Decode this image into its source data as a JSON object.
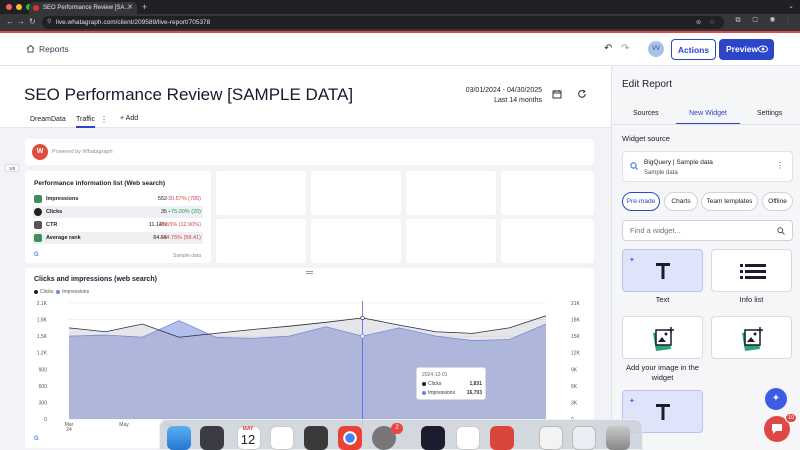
{
  "browser": {
    "tab_title": "SEO Performance Review [SA…",
    "url": "live.whatagraph.com/client/209589/live-report/705378"
  },
  "header": {
    "breadcrumb": "Reports",
    "avatar_initials": "VV",
    "actions_label": "Actions",
    "preview_label": "Preview"
  },
  "report": {
    "title": "SEO Performance Review [SAMPLE DATA]",
    "date_range": "03/01/2024 - 04/30/2025",
    "date_sub": "Last 14 months",
    "pages": [
      "DreamData",
      "Traffic"
    ],
    "add_label": "Add",
    "page_indicator": "1/6",
    "powered_by": "Powered by Whatagraph"
  },
  "perf_list": {
    "title": "Performance information list (Web search)",
    "rows": [
      {
        "label": "Impressions",
        "value": "552",
        "change": "-30.57% (795)",
        "trend": "neg"
      },
      {
        "label": "Clicks",
        "value": "35",
        "change": "+75.00% (20)",
        "trend": "pos"
      },
      {
        "label": "CTR",
        "value": "11.14%",
        "change": "-13.65% (12.90%)",
        "trend": "neg"
      },
      {
        "label": "Average rank",
        "value": "84.55",
        "change": "+44.75% (58.41)",
        "trend": "neg"
      }
    ],
    "source": "Sample data"
  },
  "chart_data": {
    "type": "line",
    "title": "Clicks and impressions (web search)",
    "x": [
      "Mar 24",
      "Apr",
      "May",
      "Jun",
      "Jul",
      "Aug",
      "Sep",
      "Oct",
      "Nov",
      "Dec",
      "Jan",
      "Feb",
      "Mar",
      "Apr"
    ],
    "xlabels_visible": [
      "Mar 24",
      "May",
      "Jun"
    ],
    "series": [
      {
        "name": "Clicks",
        "axis": "left",
        "color": "#1c1c2e",
        "values": [
          1650,
          1580,
          1720,
          1480,
          1550,
          1620,
          1680,
          1750,
          1831,
          1700,
          1580,
          1550,
          1650,
          1870
        ]
      },
      {
        "name": "Impressions",
        "axis": "right",
        "color": "#6a86e3",
        "values": [
          15000,
          15200,
          14800,
          17800,
          14800,
          14600,
          15000,
          16703,
          15000,
          16500,
          15000,
          14200,
          14400,
          17200
        ]
      }
    ],
    "y_left": {
      "ticks": [
        "0",
        "300",
        "600",
        "900",
        "1.2K",
        "1.5K",
        "1.8K",
        "2.1K"
      ],
      "min": 0,
      "max": 2100
    },
    "y_right": {
      "ticks": [
        "0",
        "3K",
        "6K",
        "9K",
        "12K",
        "15K",
        "18K",
        "21K"
      ],
      "min": 0,
      "max": 21000
    },
    "tooltip": {
      "date": "2024-12-01",
      "clicks": "1,831",
      "impressions": "16,703"
    },
    "legend": "top-left"
  },
  "panel": {
    "title": "Edit Report",
    "tabs": [
      "Sources",
      "New Widget",
      "Settings"
    ],
    "widget_source_label": "Widget source",
    "source_name": "BigQuery | Sample data",
    "source_sub": "Sample data",
    "chips": [
      "Pre-made",
      "Charts",
      "Team templates",
      "Offline"
    ],
    "search_placeholder": "Find a widget...",
    "widgets": [
      "Text",
      "Info list",
      "Add your image in the widget",
      ""
    ]
  },
  "dock": {
    "calendar_month": "MAY",
    "calendar_day": "12",
    "settings_badge": "2",
    "chat_badge": "10"
  },
  "colors": {
    "accent": "#2d45c9",
    "negative": "#d93f3f",
    "positive": "#1e9d5a",
    "impressions": "#6a86e3",
    "clicks": "#1c1c2e"
  }
}
